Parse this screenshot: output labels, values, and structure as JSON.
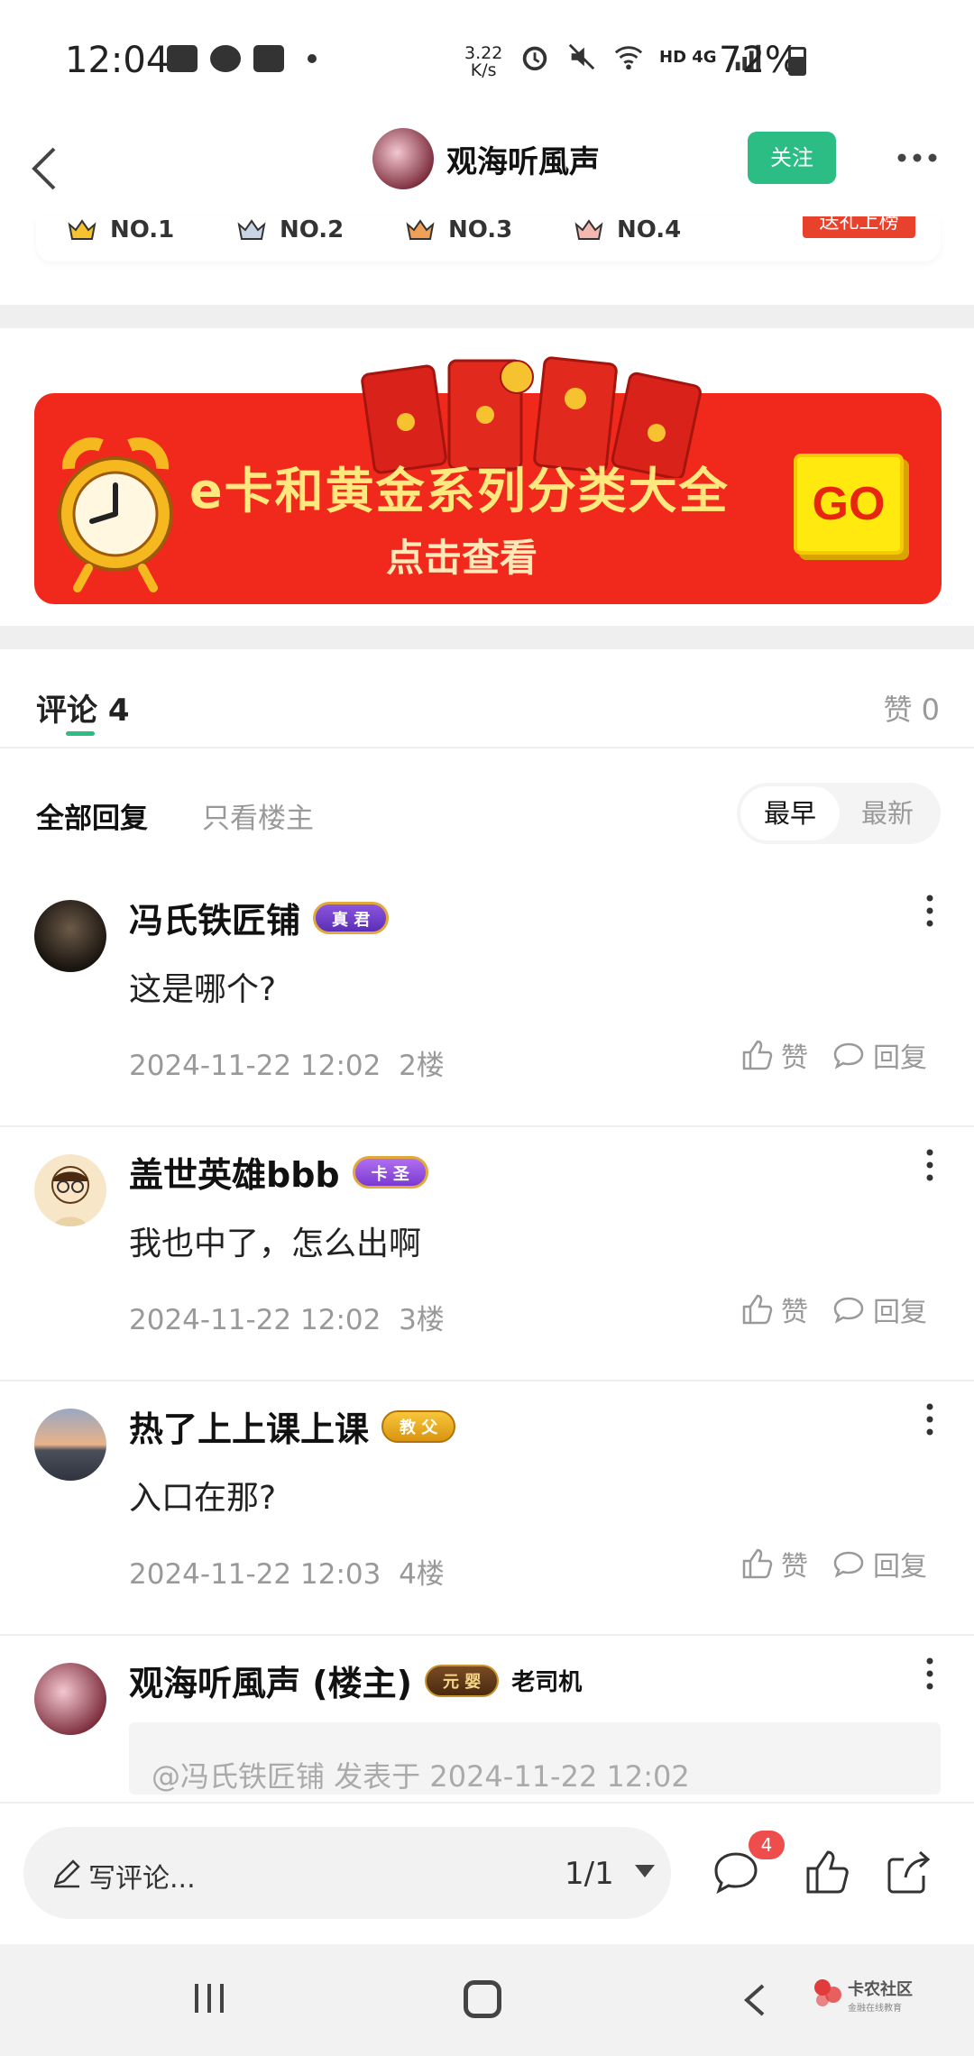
{
  "status_bar": {
    "time": "12:04",
    "net_speed_value": "3.22",
    "net_speed_unit": "K/s",
    "network": "HD 4G",
    "battery": "72%",
    "icons": [
      "gallery-icon",
      "wechat-icon",
      "message-icon",
      "alarm-icon",
      "mute-icon",
      "wifi-icon",
      "signal-icon",
      "battery-icon"
    ]
  },
  "header": {
    "title": "观海听風声",
    "follow_label": "关注"
  },
  "rank_strip": {
    "ranks": [
      "NO.1",
      "NO.2",
      "NO.3",
      "NO.4"
    ],
    "gift_label": "送礼上榜"
  },
  "banner": {
    "title": "e卡和黄金系列分类大全",
    "subtitle": "点击查看",
    "go_label": "GO"
  },
  "comments_section": {
    "title": "评论 4",
    "like_label": "赞 0",
    "filters": {
      "all": "全部回复",
      "op_only": "只看楼主"
    },
    "sort": {
      "earliest": "最早",
      "latest": "最新"
    },
    "like_action": "赞",
    "reply_action": "回复",
    "items": [
      {
        "name": "冯氏铁匠铺",
        "badge": "真 君",
        "text": "这是哪个?",
        "time": "2024-11-22 12:02",
        "floor": "2楼"
      },
      {
        "name": "盖世英雄bbb",
        "badge": "卡 圣",
        "text": "我也中了，怎么出啊",
        "time": "2024-11-22 12:02",
        "floor": "3楼"
      },
      {
        "name": "热了上上课上课",
        "badge": "教 父",
        "text": "入口在那?",
        "time": "2024-11-22 12:03",
        "floor": "4楼"
      },
      {
        "name": "观海听風声 (楼主)",
        "badge": "元 婴",
        "badge2": "老司机",
        "quote": "@冯氏铁匠铺 发表于 2024-11-22 12:02"
      }
    ]
  },
  "bottom_bar": {
    "input_placeholder": "写评论...",
    "page_indicator": "1/1",
    "comment_count": "4"
  },
  "watermark": {
    "name": "卡农社区",
    "tagline": "金融在线教育"
  }
}
